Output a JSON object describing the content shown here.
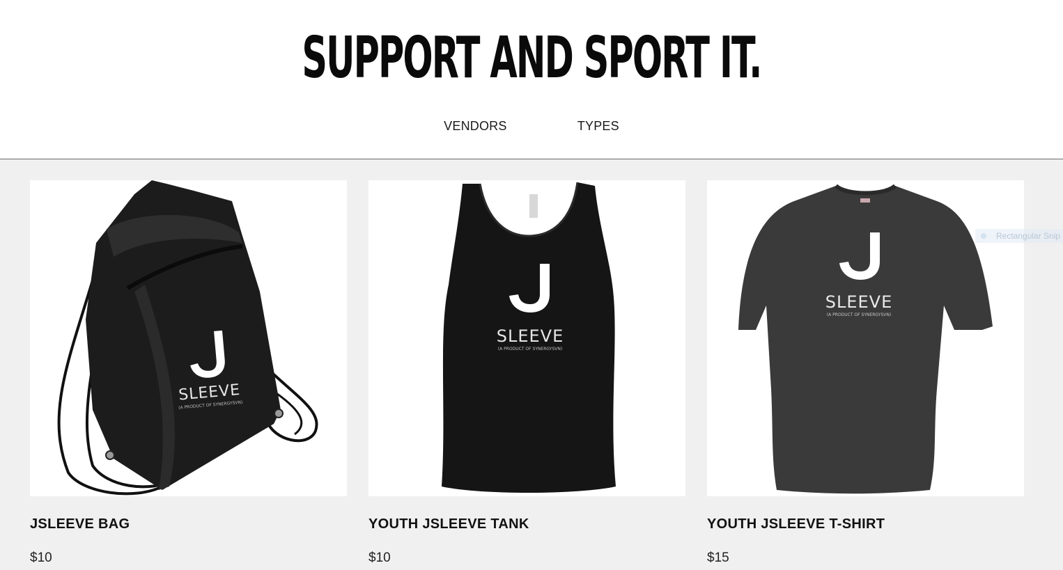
{
  "header": {
    "title": "SUPPORT AND SPORT IT.",
    "nav": [
      {
        "label": "VENDORS"
      },
      {
        "label": "TYPES"
      }
    ]
  },
  "products": [
    {
      "name": "JSLEEVE BAG",
      "price": "$10",
      "icon": "drawstring-bag-image"
    },
    {
      "name": "YOUTH JSLEEVE TANK",
      "price": "$10",
      "icon": "tank-top-image"
    },
    {
      "name": "YOUTH JSLEEVE T-SHIRT",
      "price": "$15",
      "icon": "t-shirt-image"
    }
  ],
  "logo": {
    "letter": "J",
    "word": "SLEEVE",
    "tagline": "(A PRODUCT OF SYNERGYSVN)"
  },
  "overlay": {
    "label": "Rectangular Snip"
  },
  "colors": {
    "background_catalog": "#f0f0f0",
    "bag": "#1c1c1c",
    "tank": "#151515",
    "tshirt": "#3a3a3a"
  }
}
